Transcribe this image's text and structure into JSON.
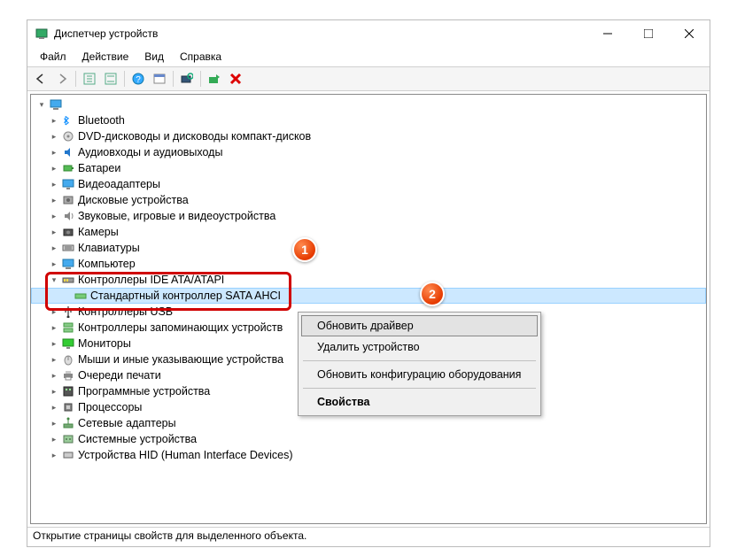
{
  "window": {
    "title": "Диспетчер устройств"
  },
  "menu": {
    "file": "Файл",
    "action": "Действие",
    "view": "Вид",
    "help": "Справка"
  },
  "tree": {
    "root": "",
    "items": [
      {
        "label": "Bluetooth"
      },
      {
        "label": "DVD-дисководы и дисководы компакт-дисков"
      },
      {
        "label": "Аудиовходы и аудиовыходы"
      },
      {
        "label": "Батареи"
      },
      {
        "label": "Видеоадаптеры"
      },
      {
        "label": "Дисковые устройства"
      },
      {
        "label": "Звуковые, игровые и видеоустройства"
      },
      {
        "label": "Камеры"
      },
      {
        "label": "Клавиатуры"
      },
      {
        "label": "Компьютер"
      }
    ],
    "ide": {
      "label": "Контроллеры IDE ATA/ATAPI",
      "child": "Стандартный контроллер SATA AHCI"
    },
    "items2": [
      {
        "label": "Контроллеры USB"
      },
      {
        "label": "Контроллеры запоминающих устройств"
      },
      {
        "label": "Мониторы"
      },
      {
        "label": "Мыши и иные указывающие устройства"
      },
      {
        "label": "Очереди печати"
      },
      {
        "label": "Программные устройства"
      },
      {
        "label": "Процессоры"
      },
      {
        "label": "Сетевые адаптеры"
      },
      {
        "label": "Системные устройства"
      },
      {
        "label": "Устройства HID (Human Interface Devices)"
      }
    ]
  },
  "context": {
    "update": "Обновить драйвер",
    "remove": "Удалить устройство",
    "scan": "Обновить конфигурацию оборудования",
    "props": "Свойства"
  },
  "badges": {
    "one": "1",
    "two": "2"
  },
  "status": "Открытие страницы свойств для выделенного объекта."
}
